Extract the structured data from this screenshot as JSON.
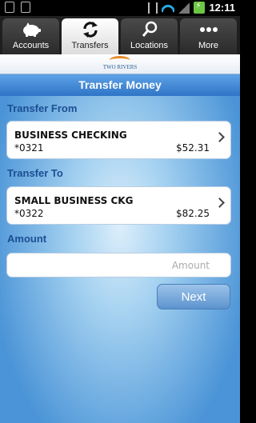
{
  "status_bar": {
    "time": "12:11",
    "icons": [
      "notification-icon",
      "usb-icon",
      "vibrate-icon",
      "wifi-icon",
      "signal-icon",
      "battery-charging-icon"
    ]
  },
  "tabs": [
    {
      "label": "Accounts",
      "icon": "piggy-bank-icon",
      "active": false
    },
    {
      "label": "Transfers",
      "icon": "transfer-arrows-icon",
      "active": true
    },
    {
      "label": "Locations",
      "icon": "magnifier-icon",
      "active": false
    },
    {
      "label": "More",
      "icon": "more-dots-icon",
      "active": false
    }
  ],
  "logo": {
    "text": "TWO RIVERS"
  },
  "page": {
    "title": "Transfer Money"
  },
  "transfer_from": {
    "label": "Transfer From",
    "account_name": "BUSINESS CHECKING",
    "account_number": "*0321",
    "balance": "$52.31"
  },
  "transfer_to": {
    "label": "Transfer To",
    "account_name": "SMALL BUSINESS CKG",
    "account_number": "*0322",
    "balance": "$82.25"
  },
  "amount": {
    "label": "Amount",
    "placeholder": "Amount",
    "value": ""
  },
  "next_button": {
    "label": "Next"
  },
  "colors": {
    "accent": "#2f75c7",
    "section_label": "#1b4f93"
  }
}
